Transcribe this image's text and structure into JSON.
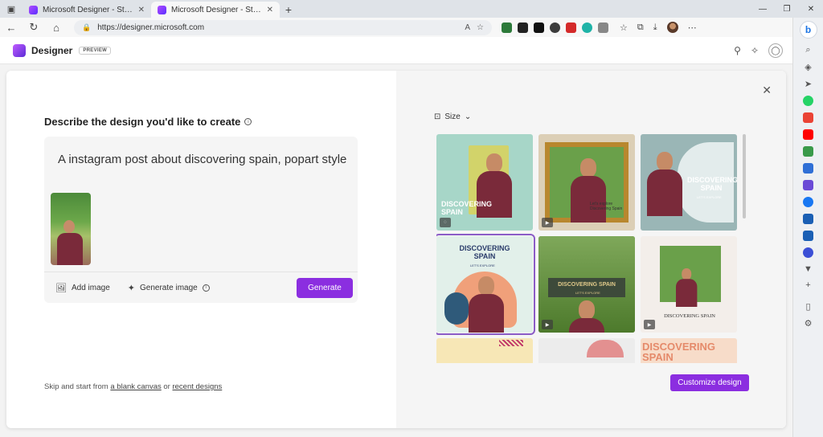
{
  "browser": {
    "tabs": [
      {
        "title": "Microsoft Designer - Stunning de",
        "active": false
      },
      {
        "title": "Microsoft Designer - Stunning de",
        "active": true
      }
    ],
    "url": "https://designer.microsoft.com"
  },
  "app": {
    "brand": "Designer",
    "badge": "PREVIEW"
  },
  "prompt": {
    "title": "Describe the design you'd like to create",
    "text": "A instagram post about discovering spain, popart style",
    "add_image": "Add image",
    "generate_image": "Generate image",
    "generate_button": "Generate"
  },
  "skip": {
    "prefix": "Skip and start from",
    "blank_link": "a blank canvas",
    "or": "or",
    "recent_link": "recent designs"
  },
  "results": {
    "size_label": "Size",
    "cards": [
      {
        "label": "DISCOVERING SPAIN",
        "sub": ""
      },
      {
        "label": "",
        "sub": "Let's explore Discovering Spain"
      },
      {
        "label": "DISCOVERING SPAIN",
        "sub": "LET'S EXPLORE"
      },
      {
        "label": "DISCOVERING SPAIN",
        "sub": "LET'S EXPLORE"
      },
      {
        "label": "DISCOVERING SPAIN",
        "sub": "LET'S EXPLORE"
      },
      {
        "label": "DISCOVERING SPAIN",
        "sub": ""
      },
      {
        "label": "",
        "sub": ""
      },
      {
        "label": "",
        "sub": ""
      },
      {
        "label": "DISCOVERING SPAIN",
        "sub": ""
      }
    ],
    "customize_button": "Customize design"
  },
  "colors": {
    "accent": "#8b2ee0"
  }
}
